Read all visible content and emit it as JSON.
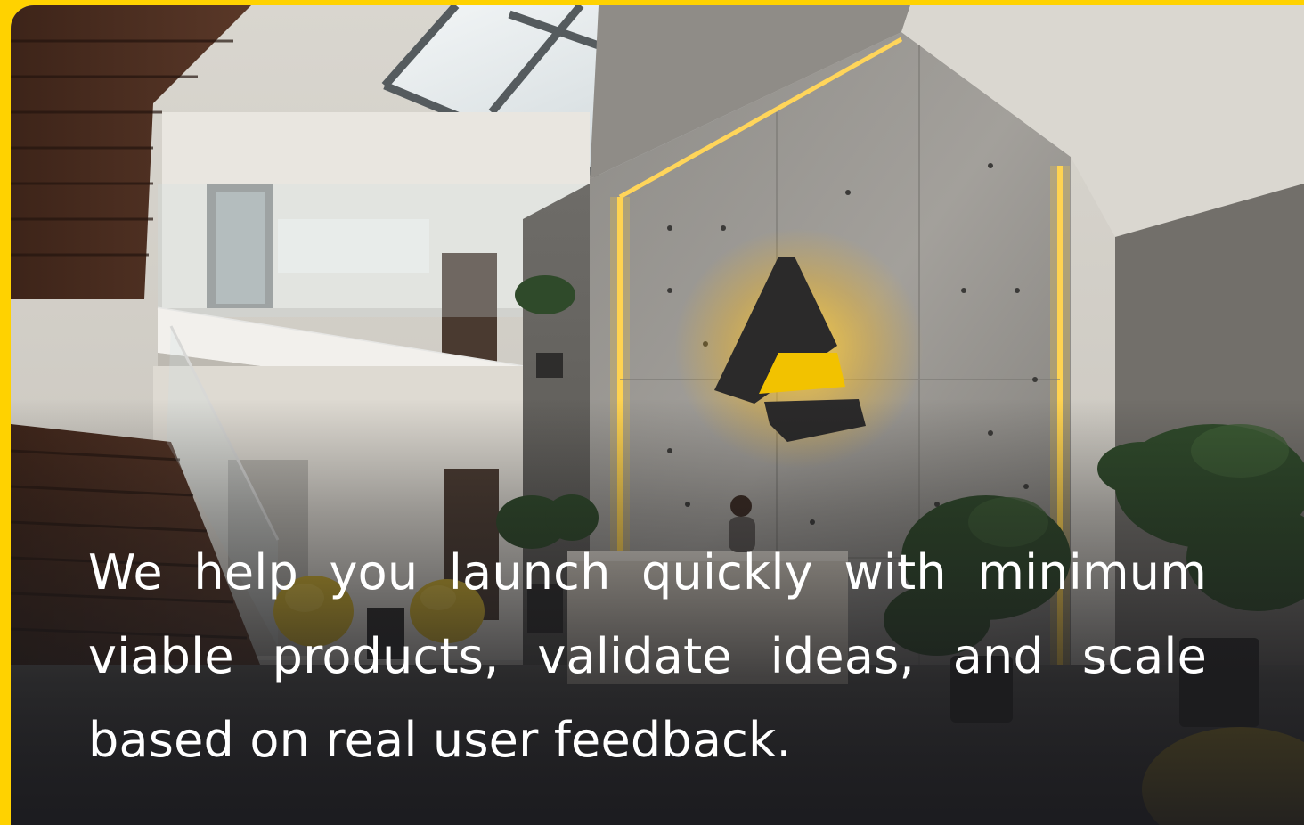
{
  "hero": {
    "caption": "We help you launch quickly with minimum viable products, validate ideas, and scale based on real user feedback."
  },
  "colors": {
    "frame_accent": "#ffd200",
    "logo_dark": "#2b2a2a",
    "logo_accent": "#f2c200",
    "caption_text": "#ffffff"
  },
  "image": {
    "subject": "office-atrium-photo",
    "icons": [
      "company-logo-icon"
    ]
  }
}
